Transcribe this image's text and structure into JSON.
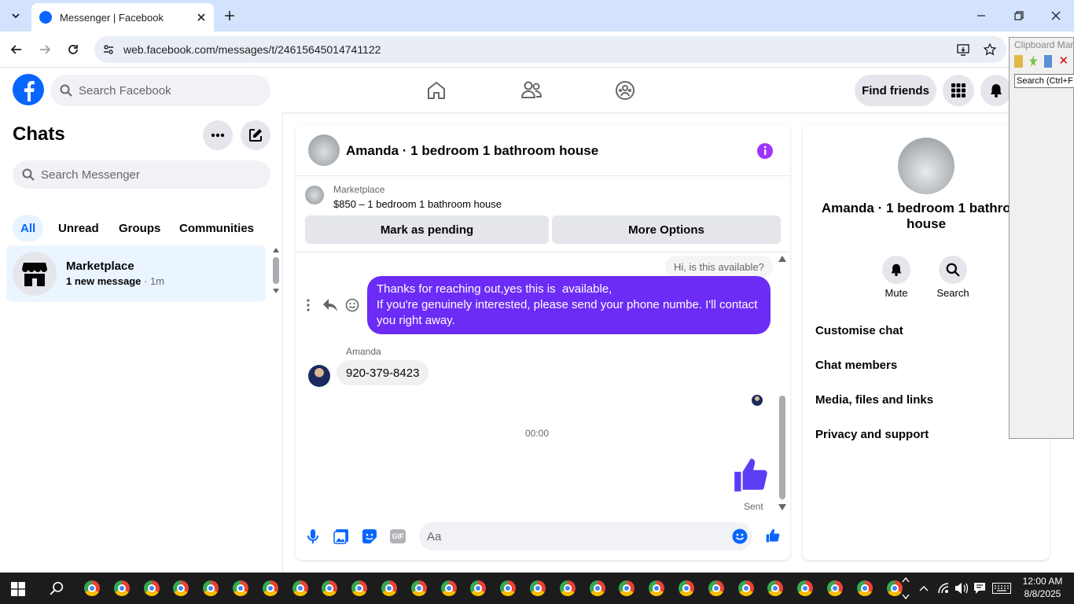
{
  "browser": {
    "tab_title": "Messenger | Facebook",
    "url": "web.facebook.com/messages/t/24615645014741122"
  },
  "clipboard_panel": {
    "title": "Clipboard Mar",
    "search_placeholder": "Search (Ctrl+F"
  },
  "header": {
    "search_placeholder": "Search Facebook",
    "find_friends": "Find friends"
  },
  "sidebar": {
    "title": "Chats",
    "search_placeholder": "Search Messenger",
    "filters": [
      "All",
      "Unread",
      "Groups",
      "Communities"
    ],
    "active_filter": "All",
    "chats": [
      {
        "name": "Marketplace",
        "preview": "1 new message",
        "time": "1m"
      }
    ]
  },
  "conversation": {
    "title": "Amanda · 1 bedroom 1 bathroom house",
    "listing_label": "Marketplace",
    "listing_detail": "$850 – 1 bedroom 1 bathroom house",
    "mark_pending": "Mark as pending",
    "more_options": "More Options",
    "quoted_message": "Hi, is this available?",
    "outgoing_message": "Thanks for reaching out,yes this is  available,\nIf you're genuinely interested, please send your phone numbe. I'll contact you right away.",
    "sender_name": "Amanda",
    "incoming_message": "920-379-8423",
    "call_time": "00:00",
    "sent_status": "Sent",
    "composer_placeholder": "Aa",
    "gif_label": "GIF"
  },
  "details": {
    "name": "Amanda · 1 bedroom 1 bathroom house",
    "actions": [
      "Mute",
      "Search"
    ],
    "sections": [
      "Customise chat",
      "Chat members",
      "Media, files and links",
      "Privacy and support"
    ]
  },
  "taskbar": {
    "time": "12:00 AM",
    "date": "8/8/2025"
  },
  "colors": {
    "accent": "#0866ff",
    "messenger_purple": "#6c2cf5",
    "bubble_gray": "#f0f0f0",
    "button_gray": "#e4e6eb"
  }
}
